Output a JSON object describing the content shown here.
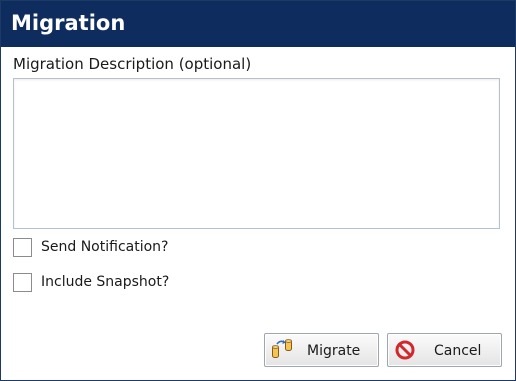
{
  "dialog": {
    "title": "Migration"
  },
  "description": {
    "label": "Migration Description (optional)",
    "value": ""
  },
  "options": [
    {
      "label": "Send Notification?",
      "checked": false
    },
    {
      "label": "Include Snapshot?",
      "checked": false
    }
  ],
  "buttons": {
    "migrate": {
      "label": "Migrate",
      "icon": "migrate-icon"
    },
    "cancel": {
      "label": "Cancel",
      "icon": "cancel-icon"
    }
  },
  "colors": {
    "title_bar": "#0e2d5e",
    "title_text": "#ffffff",
    "cancel_icon": "#d0282d",
    "migrate_icon": "#e0a43a"
  }
}
